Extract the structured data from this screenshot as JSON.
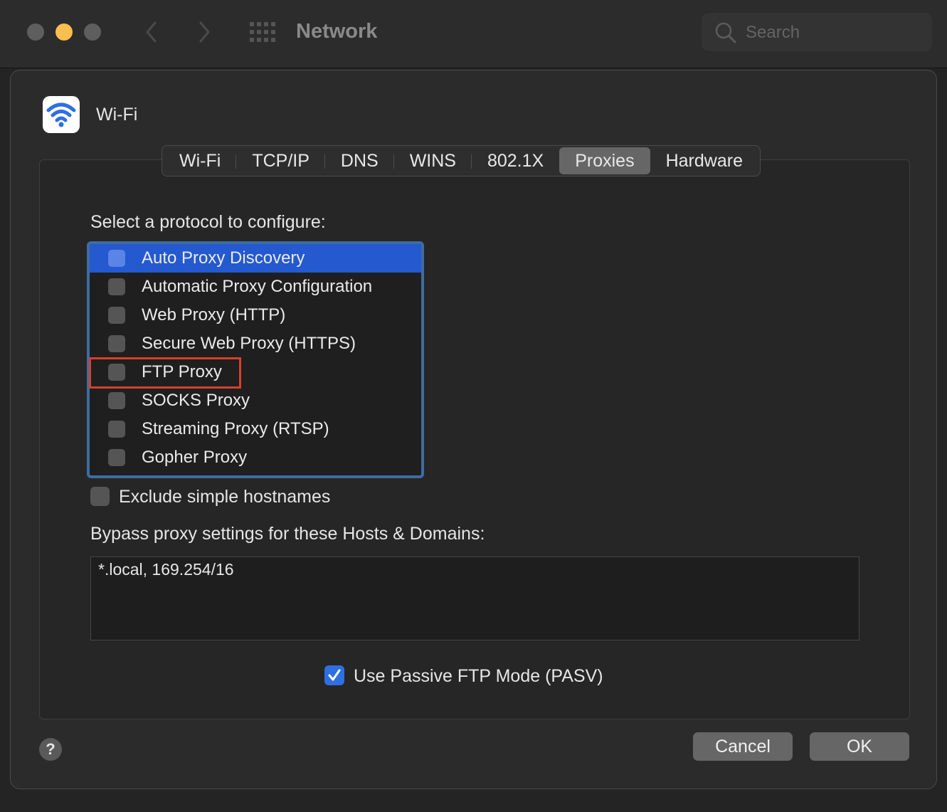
{
  "window": {
    "title": "Network",
    "search_placeholder": "Search"
  },
  "interface": {
    "name": "Wi-Fi"
  },
  "tabs": [
    {
      "label": "Wi-Fi"
    },
    {
      "label": "TCP/IP"
    },
    {
      "label": "DNS"
    },
    {
      "label": "WINS"
    },
    {
      "label": "802.1X"
    },
    {
      "label": "Proxies",
      "active": true
    },
    {
      "label": "Hardware"
    }
  ],
  "proxies": {
    "select_label": "Select a protocol to configure:",
    "protocols": [
      {
        "label": "Auto Proxy Discovery",
        "checked": false,
        "selected": true
      },
      {
        "label": "Automatic Proxy Configuration",
        "checked": false
      },
      {
        "label": "Web Proxy (HTTP)",
        "checked": false
      },
      {
        "label": "Secure Web Proxy (HTTPS)",
        "checked": false
      },
      {
        "label": "FTP Proxy",
        "checked": false,
        "highlighted": true
      },
      {
        "label": "SOCKS Proxy",
        "checked": false
      },
      {
        "label": "Streaming Proxy (RTSP)",
        "checked": false
      },
      {
        "label": "Gopher Proxy",
        "checked": false
      }
    ],
    "exclude_simple_label": "Exclude simple hostnames",
    "exclude_simple_checked": false,
    "bypass_label": "Bypass proxy settings for these Hosts & Domains:",
    "bypass_value": "*.local, 169.254/16",
    "pasv_label": "Use Passive FTP Mode (PASV)",
    "pasv_checked": true
  },
  "footer": {
    "help_label": "?",
    "cancel_label": "Cancel",
    "ok_label": "OK"
  },
  "colors": {
    "selection": "#2459cf",
    "highlight_box": "#d6402e",
    "checkbox_checked": "#2f6fe0",
    "wifi_icon": "#2f6fe0"
  }
}
